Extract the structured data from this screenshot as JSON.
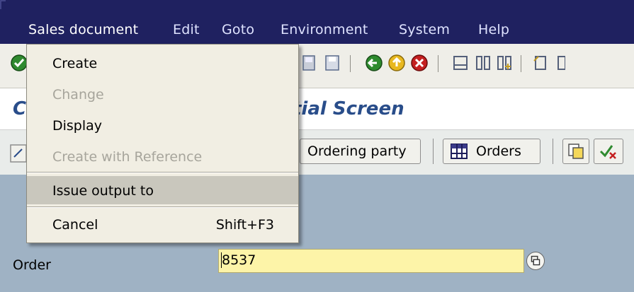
{
  "menubar": {
    "items": [
      "Sales document",
      "Edit",
      "Goto",
      "Environment",
      "System",
      "Help"
    ]
  },
  "title": {
    "prefix": "C",
    "suffix": "tial Screen"
  },
  "app_toolbar": {
    "ordering_party": "Ordering party",
    "orders": "Orders"
  },
  "dropdown": {
    "items": [
      {
        "label": "Create",
        "shortcut": ""
      },
      {
        "label": "Change",
        "shortcut": ""
      },
      {
        "label": "Display",
        "shortcut": ""
      },
      {
        "label": "Create with Reference",
        "shortcut": ""
      },
      {
        "label": "Issue output to",
        "shortcut": ""
      },
      {
        "label": "Cancel",
        "shortcut": "Shift+F3"
      }
    ]
  },
  "form": {
    "order_label": "Order",
    "order_value": "8537"
  },
  "colors": {
    "menubar_bg": "#1f2160",
    "title_text": "#294d8a",
    "main_bg": "#9fb2c4",
    "field_bg": "#fdf4a8",
    "dropdown_bg": "#f1eee3"
  },
  "icons": [
    "enter-icon",
    "save-icon",
    "back-icon",
    "exit-icon",
    "cancel-icon",
    "print-icon",
    "find-icon",
    "find-next-icon",
    "new-session-icon",
    "create-icon",
    "display-change-icon",
    "layout-icon",
    "check-icon",
    "orders-icon",
    "matchcode-icon"
  ]
}
